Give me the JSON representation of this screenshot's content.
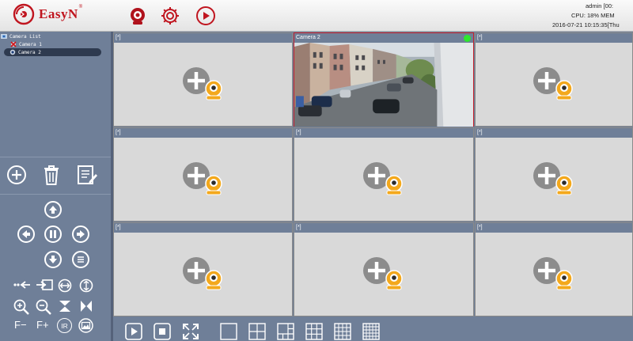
{
  "app": {
    "brand": "EasyN",
    "brand_mark": "®",
    "top_icons": [
      "camera-settings-icon",
      "gear-icon",
      "play-record-icon"
    ]
  },
  "status": {
    "user_line": "admin  [00:",
    "cpu_line": "CPU: 18%  MEM",
    "datetime_line": "2016-07-21 10:15:35[Thu"
  },
  "tree": {
    "root": "Camera List",
    "items": [
      {
        "label": "Camera 1",
        "state": "disconnected"
      },
      {
        "label": "Camera 2",
        "state": "connected",
        "selected": true
      }
    ]
  },
  "tools": [
    "add-icon",
    "trash-icon",
    "edit-icon"
  ],
  "ptz": {
    "arrows": [
      "up",
      "left",
      "pause",
      "right",
      "down",
      "preset"
    ],
    "text_buttons": [
      "F−",
      "F+",
      "IR"
    ]
  },
  "grid": {
    "rows": 3,
    "cols": 3,
    "cells": [
      {
        "title": "[*]",
        "state": "empty"
      },
      {
        "title": "Camera 2",
        "state": "live"
      },
      {
        "title": "[*]",
        "state": "empty"
      },
      {
        "title": "[*]",
        "state": "empty"
      },
      {
        "title": "[*]",
        "state": "empty"
      },
      {
        "title": "[*]",
        "state": "empty"
      },
      {
        "title": "[*]",
        "state": "empty"
      },
      {
        "title": "[*]",
        "state": "empty"
      },
      {
        "title": "[*]",
        "state": "empty"
      }
    ]
  },
  "bottom": {
    "controls": [
      "play-icon",
      "stop-icon",
      "fullscreen-icon"
    ],
    "layouts": [
      "layout-1",
      "layout-4",
      "layout-6",
      "layout-9",
      "layout-16",
      "layout-25"
    ]
  },
  "colors": {
    "brand_red": "#c0151f",
    "panel": "#6f7f98",
    "live": "#2ee82e"
  }
}
